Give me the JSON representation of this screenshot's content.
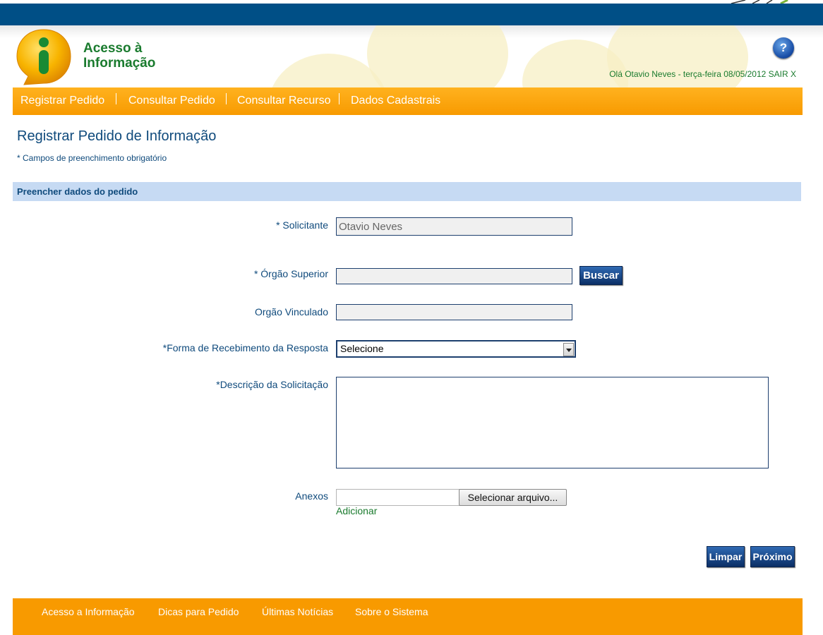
{
  "header": {
    "logo_text": [
      "Acesso à",
      "Informação"
    ],
    "help_label": "?",
    "greeting": "Olá Otavio Neves - terça-feira 08/05/2012 SAIR X"
  },
  "nav": {
    "items": [
      "Registrar Pedido",
      "Consultar Pedido",
      "Consultar Recurso",
      "Dados Cadastrais"
    ]
  },
  "page": {
    "title": "Registrar Pedido de Informação",
    "required_note": "* Campos de preenchimento obrigatório",
    "section_title": "Preencher dados do pedido"
  },
  "form": {
    "solicitante_label": "* Solicitante",
    "solicitante_value": "Otavio Neves",
    "orgao_superior_label": "* Órgão Superior",
    "orgao_superior_value": "",
    "buscar_label": "Buscar",
    "orgao_vinculado_label": "Orgão Vinculado",
    "orgao_vinculado_value": "",
    "forma_label": "*Forma de Recebimento da Resposta",
    "forma_selected": "Selecione",
    "descricao_label": "*Descrição da Solicitação",
    "descricao_value": "",
    "anexos_label": "Anexos",
    "file_button_label": "Selecionar arquivo...",
    "adicionar_label": "Adicionar",
    "limpar_label": "Limpar",
    "proximo_label": "Próximo"
  },
  "footer": {
    "items": [
      "Acesso a Informação",
      "Dicas para Pedido",
      "Últimas Notícias",
      "Sobre o Sistema"
    ]
  },
  "colors": {
    "top_band": "#004f86",
    "orange": "#f89a00",
    "navy_text": "#0f4a7c",
    "green_text": "#1a7b2e",
    "section_bar": "#c6daf3"
  }
}
